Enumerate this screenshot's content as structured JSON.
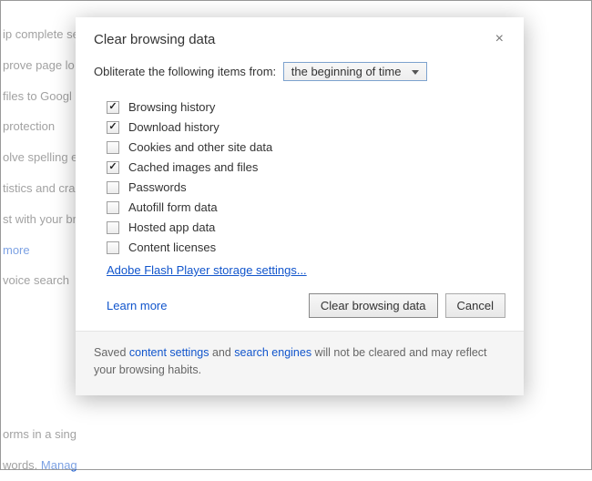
{
  "background": {
    "lines": [
      "ip complete searches and URLs typed in the address bar or the app",
      "prove page lo",
      "files to Googl",
      " protection",
      "olve spelling e",
      "tistics and cra",
      "st with your br",
      "",
      " voice search",
      "",
      "",
      "",
      "",
      "orms in a sing"
    ],
    "learn_more": "more",
    "last_prefix": "words.  ",
    "last_link": "Manag"
  },
  "dialog": {
    "title": "Clear browsing data",
    "close_icon": "×",
    "from_label": "Obliterate the following items from:",
    "time_range_selected": "the beginning of time",
    "options": [
      {
        "label": "Browsing history",
        "checked": true
      },
      {
        "label": "Download history",
        "checked": true
      },
      {
        "label": "Cookies and other site data",
        "checked": false
      },
      {
        "label": "Cached images and files",
        "checked": true
      },
      {
        "label": "Passwords",
        "checked": false
      },
      {
        "label": "Autofill form data",
        "checked": false
      },
      {
        "label": "Hosted app data",
        "checked": false
      },
      {
        "label": "Content licenses",
        "checked": false
      }
    ],
    "flash_link": "Adobe Flash Player storage settings...",
    "learn_more": "Learn more",
    "primary_btn": "Clear browsing data",
    "cancel_btn": "Cancel",
    "footer_prefix": "Saved ",
    "footer_link1": "content settings",
    "footer_mid": " and ",
    "footer_link2": "search engines",
    "footer_suffix": " will not be cleared and may reflect your browsing habits."
  }
}
